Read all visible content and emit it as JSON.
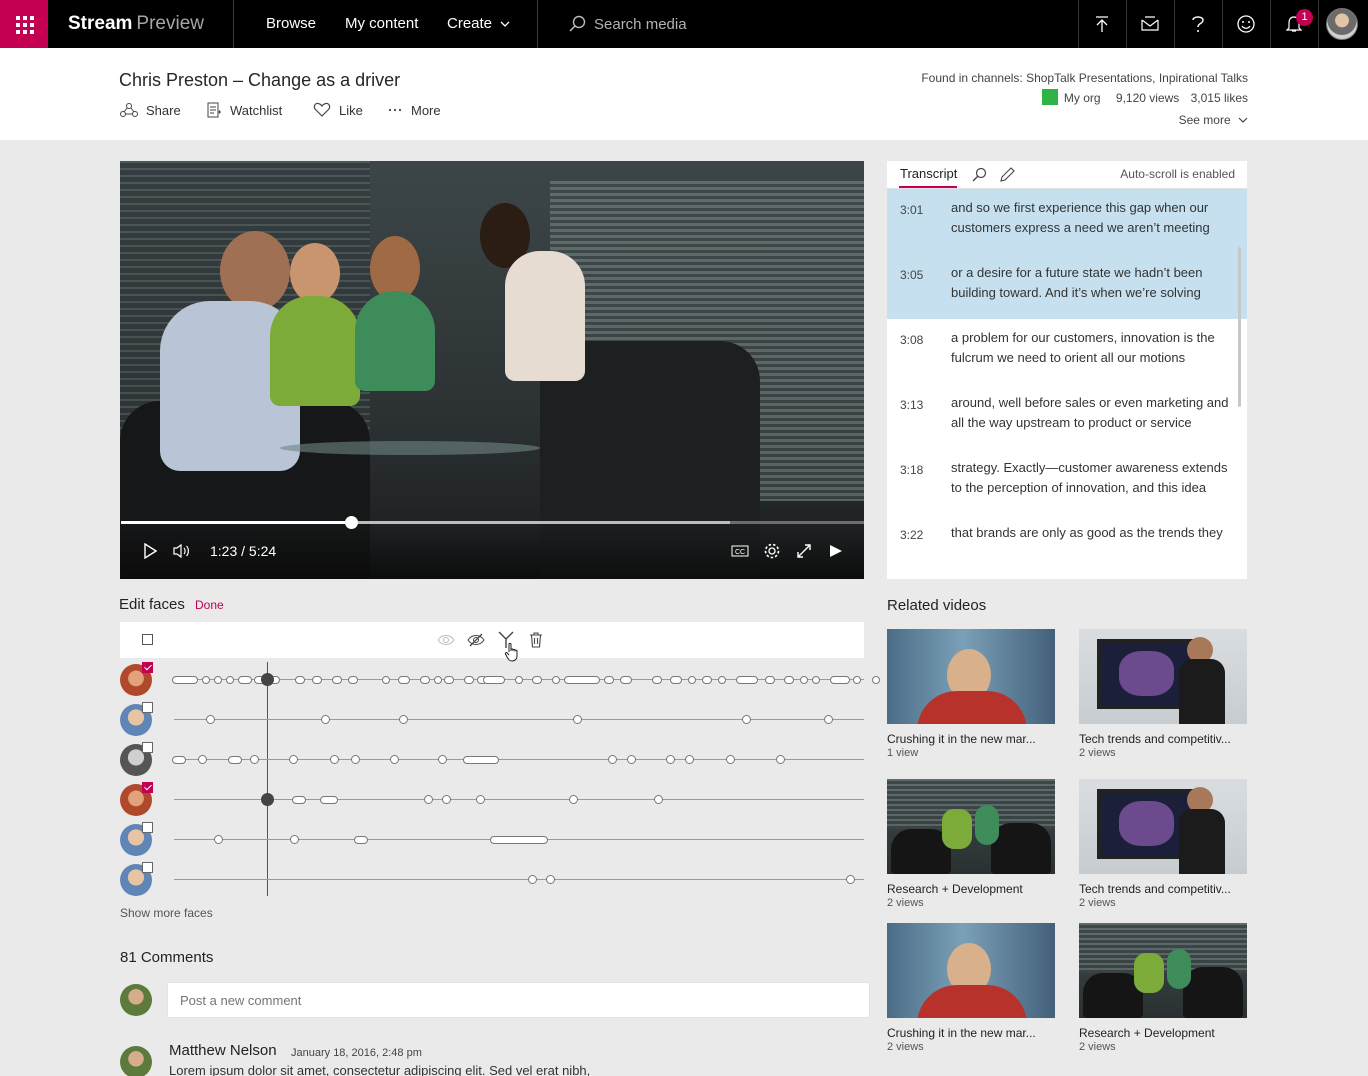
{
  "topbar": {
    "brand_bold": "Stream",
    "brand_light": "Preview",
    "nav": [
      "Browse",
      "My content",
      "Create"
    ],
    "search_placeholder": "Search media",
    "notification_count": "1",
    "accent_color": "#c30052"
  },
  "video_header": {
    "title": "Chris Preston – Change as a driver",
    "actions": [
      "Share",
      "Watchlist",
      "Like",
      "More"
    ],
    "channels_label": "Found in channels: ShopTalk Presentations, Inpirational Talks",
    "org": "My org",
    "views": "9,120 views",
    "likes": "3,015 likes",
    "see_more": "See more"
  },
  "player": {
    "time": "1:23 / 5:24",
    "progress_fraction": 0.31,
    "buffered_fraction": 0.82
  },
  "transcript": {
    "tab": "Transcript",
    "autoscroll": "Auto-scroll is enabled",
    "lines": [
      {
        "time": "3:01",
        "text": "and so we first experience this gap when our customers express a need we aren’t meeting",
        "highlight": true
      },
      {
        "time": "3:05",
        "text": " or a desire for a future state we hadn’t been building toward. And it’s when we’re solving",
        "highlight": true
      },
      {
        "time": "3:08",
        "text": "a problem for our customers, innovation is the fulcrum we need to orient all our motions",
        "highlight": false
      },
      {
        "time": "3:13",
        "text": "around, well before sales or even marketing and all the way upstream to product or service",
        "highlight": false
      },
      {
        "time": "3:18",
        "text": "strategy. Exactly—customer awareness extends to the perception of innovation, and this idea",
        "highlight": false
      },
      {
        "time": "3:22",
        "text": "that brands are only as good as the trends they",
        "highlight": false
      }
    ]
  },
  "edit_faces": {
    "title": "Edit faces",
    "done": "Done",
    "show_more": "Show more faces",
    "faces": [
      {
        "checked": true
      },
      {
        "checked": false
      },
      {
        "checked": false
      },
      {
        "checked": true
      },
      {
        "checked": false
      },
      {
        "checked": false
      }
    ]
  },
  "comments": {
    "title": "81 Comments",
    "placeholder": "Post a new comment",
    "items": [
      {
        "name": "Matthew Nelson",
        "date": "January 18, 2016, 2:48 pm",
        "body": "Lorem ipsum dolor sit amet, consectetur adipiscing elit. Sed vel erat nibh,"
      }
    ]
  },
  "related": {
    "title": "Related videos",
    "items": [
      {
        "name": "Crushing it in the new mar...",
        "views": "1 view",
        "thumb": "th-a"
      },
      {
        "name": "Tech trends and competitiv...",
        "views": "2 views",
        "thumb": "th-b"
      },
      {
        "name": "Research + Development",
        "views": "2 views",
        "thumb": "th-c"
      },
      {
        "name": "Tech trends and competitiv...",
        "views": "2 views",
        "thumb": "th-b"
      },
      {
        "name": "Crushing it in the new mar...",
        "views": "2 views",
        "thumb": "th-a"
      },
      {
        "name": "Research + Development",
        "views": "2 views",
        "thumb": "th-c"
      }
    ]
  }
}
